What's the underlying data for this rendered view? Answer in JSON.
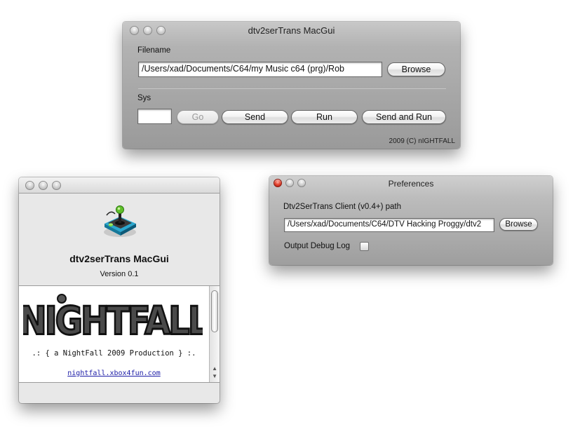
{
  "main_window": {
    "title": "dtv2serTrans MacGui",
    "filename_label": "Filename",
    "filename_value": "/Users/xad/Documents/C64/my Music c64 (prg)/Rob",
    "browse_label": "Browse",
    "sys_label": "Sys",
    "sys_value": "",
    "go_label": "Go",
    "send_label": "Send",
    "run_label": "Run",
    "send_and_run_label": "Send and Run",
    "copyright": "2009 (C) nIGHTFALL"
  },
  "about_window": {
    "app_name": "dtv2serTrans MacGui",
    "version": "Version 0.1",
    "logo_text": "NIGHTFALL",
    "production_line": ".: { a NightFall 2009 Production } :.",
    "link": "nightfall.xbox4fun.com"
  },
  "prefs_window": {
    "title": "Preferences",
    "client_path_label": "Dtv2SerTrans Client (v0.4+) path",
    "client_path_value": "/Users/xad/Documents/C64/DTV Hacking Proggy/dtv2",
    "browse_label": "Browse",
    "debug_log_label": "Output Debug Log",
    "debug_log_checked": false
  },
  "colors": {
    "window_gray_top": "#c8c8c8",
    "window_gray_bottom": "#9a9a9a",
    "close_red": "#e23f2b",
    "link_blue": "#1a1aa6"
  },
  "icons": {
    "app_icon": "joystick-icon"
  }
}
